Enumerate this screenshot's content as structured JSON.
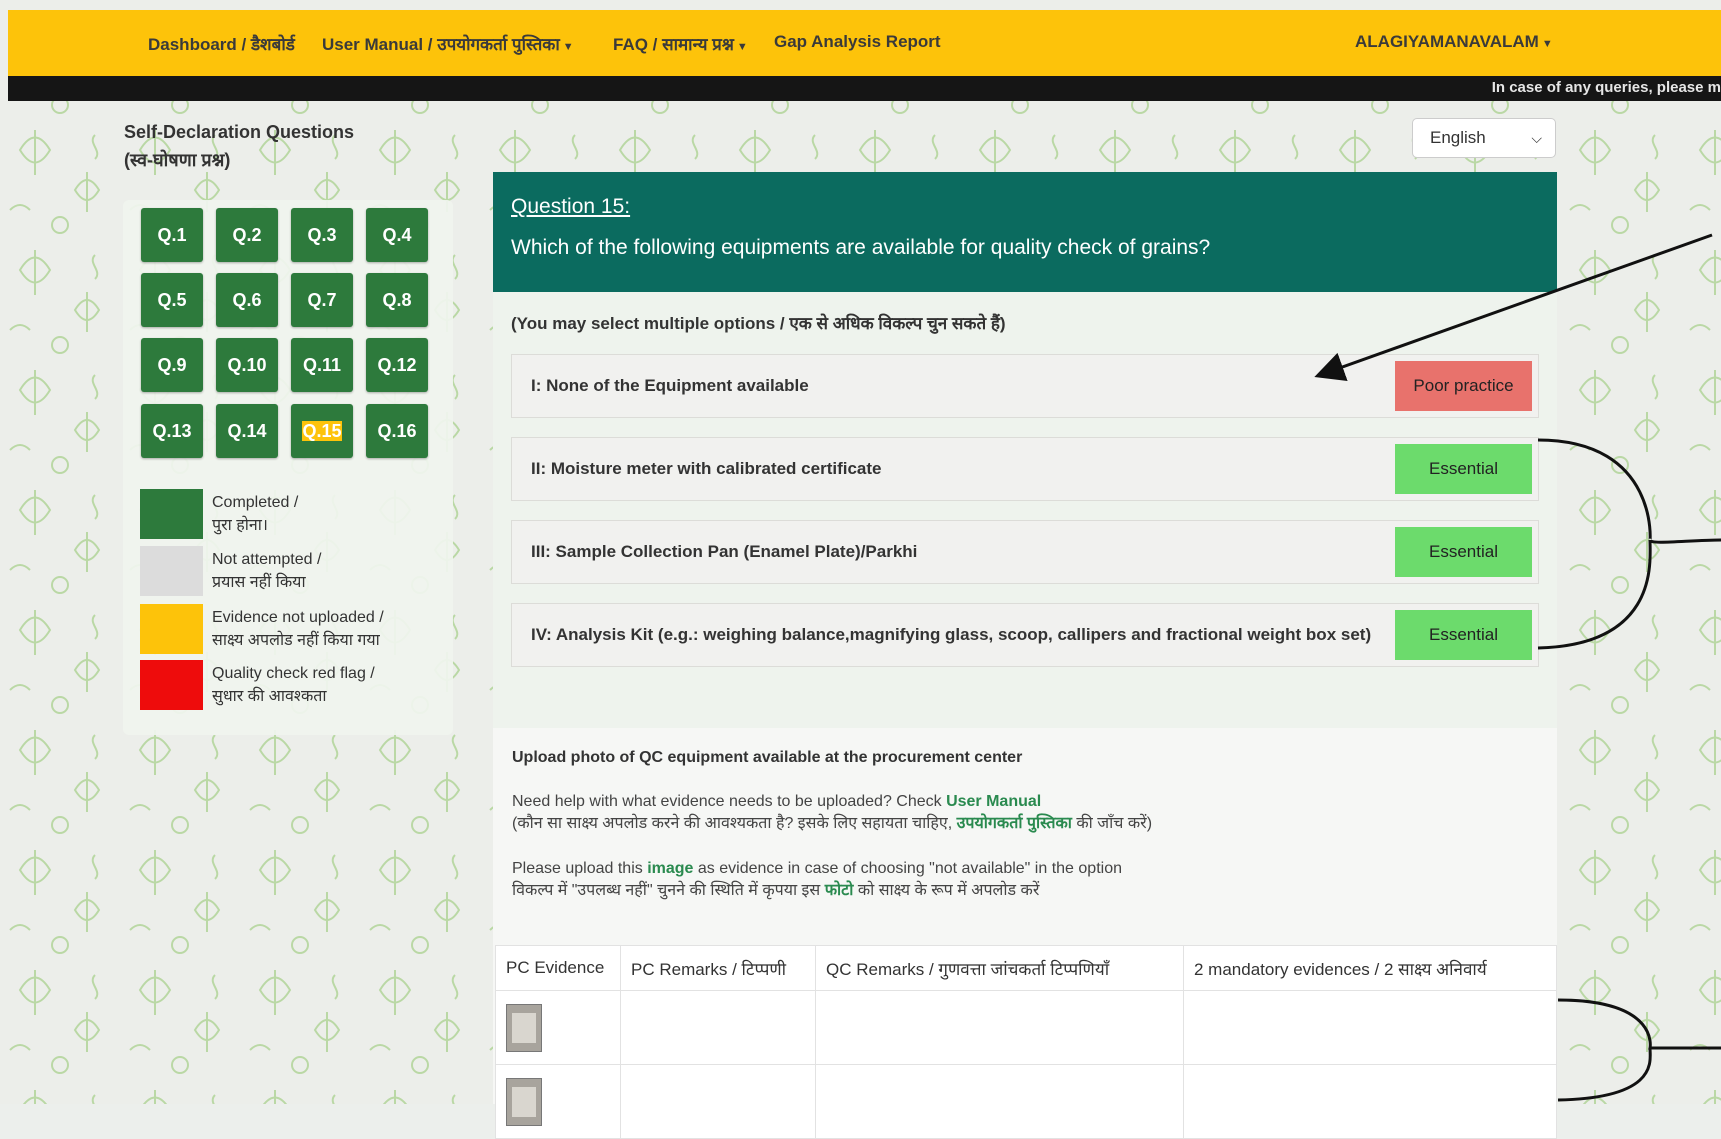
{
  "nav": {
    "dashboard": "Dashboard / डैशबोर्ड",
    "user_manual": "User Manual / उपयोगकर्ता पुस्तिका",
    "faq": "FAQ / सामान्य प्रश्न",
    "gap_report": "Gap Analysis Report",
    "user": "ALAGIYAMANAVALAM"
  },
  "notice": "In case of any queries, please m",
  "sidebar": {
    "title_line1": "Self-Declaration Questions",
    "title_line2": "(स्व-घोषणा प्रश्न)",
    "questions": [
      "Q.1",
      "Q.2",
      "Q.3",
      "Q.4",
      "Q.5",
      "Q.6",
      "Q.7",
      "Q.8",
      "Q.9",
      "Q.10",
      "Q.11",
      "Q.12",
      "Q.13",
      "Q.14",
      "Q.15",
      "Q.16"
    ],
    "current": "Q.15",
    "legend": [
      {
        "label": "Completed /\nपुरा होना।",
        "color": "#2d7a3c"
      },
      {
        "label": "Not attempted /\nप्रयास नहीं किया",
        "color": "#dcdcdc"
      },
      {
        "label": "Evidence not uploaded /\nसाक्ष्य अपलोड नहीं किया गया",
        "color": "#fdc30a"
      },
      {
        "label": "Quality check red flag /\nसुधार की आवश्कता",
        "color": "#ee0c0c"
      }
    ]
  },
  "language": {
    "selected": "English"
  },
  "question": {
    "number": "Question 15:",
    "text": "Which of the following equipments are available for quality check of grains?",
    "hint": "(You may select multiple options / एक से अधिक विकल्प चुन सकते हैं)",
    "options": [
      {
        "text": "I: None of the Equipment available",
        "tag": "Poor practice",
        "tag_color": "#e8726c"
      },
      {
        "text": "II: Moisture meter with calibrated certificate",
        "tag": "Essential",
        "tag_color": "#6cdb6c"
      },
      {
        "text": "III: Sample Collection Pan (Enamel Plate)/Parkhi",
        "tag": "Essential",
        "tag_color": "#6cdb6c"
      },
      {
        "text": "IV: Analysis Kit (e.g.: weighing balance,magnifying glass, scoop, callipers and fractional weight box set)",
        "tag": "Essential",
        "tag_color": "#6cdb6c"
      }
    ]
  },
  "evidence": {
    "title": "Upload photo of QC equipment available at the procurement center",
    "help_prefix": "Need help with what evidence needs to be uploaded? Check ",
    "help_link": "User Manual",
    "help_hi_prefix": "(कौन सा साक्ष्य अपलोड करने की आवश्यकता है? इसके लिए सहायता चाहिए, ",
    "help_hi_link": "उपयोगकर्ता पुस्तिका",
    "help_hi_suffix": " की जाँच करें)",
    "upload_prefix": "Please upload this ",
    "upload_link": "image",
    "upload_suffix": " as evidence in case of choosing \"not available\" in the option",
    "upload_hi_prefix": "विकल्प में \"उपलब्ध नहीं\" चुनने की स्थिति में कृपया इस ",
    "upload_hi_link": "फोटो",
    "upload_hi_suffix": " को साक्ष्य के रूप में अपलोड करें",
    "table_headers": [
      "PC Evidence",
      "PC Remarks / टिप्पणी",
      "QC Remarks / गुणवत्ता जांचकर्ता टिप्पणियाँ",
      "2 mandatory evidences / 2 साक्ष्य अनिवार्य"
    ]
  }
}
